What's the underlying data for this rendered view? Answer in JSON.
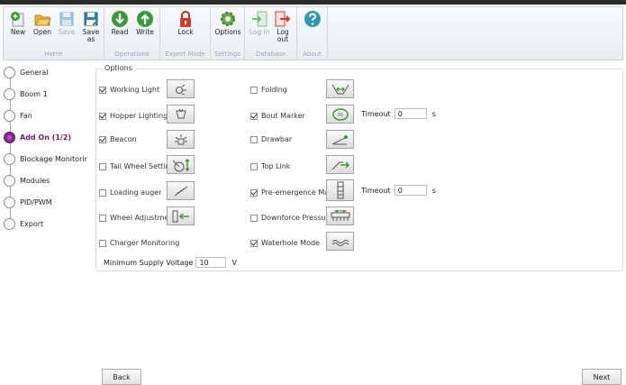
{
  "ribbon": {
    "groups": [
      {
        "label": "Home",
        "buttons": [
          {
            "label": "New"
          },
          {
            "label": "Open"
          },
          {
            "label": "Save"
          },
          {
            "label": "Save as"
          }
        ]
      },
      {
        "label": "Operations",
        "buttons": [
          {
            "label": "Read"
          },
          {
            "label": "Write"
          }
        ]
      },
      {
        "label": "Expert Mode",
        "buttons": [
          {
            "label": "Lock"
          }
        ]
      },
      {
        "label": "Settings",
        "buttons": [
          {
            "label": "Options"
          }
        ]
      },
      {
        "label": "Database",
        "buttons": [
          {
            "label": "Log in"
          },
          {
            "label": "Log out"
          }
        ]
      },
      {
        "label": "About",
        "buttons": [
          {
            "label": ""
          }
        ]
      }
    ]
  },
  "nav": {
    "items": [
      {
        "label": "General"
      },
      {
        "label": "Boom 1"
      },
      {
        "label": "Fan"
      },
      {
        "label": "Add On (1/2)"
      },
      {
        "label": "Blockage Monitorir"
      },
      {
        "label": "Modules"
      },
      {
        "label": "PID/PWM"
      },
      {
        "label": "Export"
      }
    ]
  },
  "options": {
    "title": "Options",
    "left": [
      {
        "label": "Working Light",
        "checked": true
      },
      {
        "label": "Hopper Lighting",
        "checked": true
      },
      {
        "label": "Beacon",
        "checked": true
      },
      {
        "label": "Tail Wheel Setting",
        "checked": false
      },
      {
        "label": "Loading auger",
        "checked": false
      },
      {
        "label": "Wheel Adjustment",
        "checked": false
      },
      {
        "label": "Charger Monitoring",
        "checked": false
      }
    ],
    "right": [
      {
        "label": "Folding",
        "checked": false
      },
      {
        "label": "Bout Marker",
        "checked": true
      },
      {
        "label": "Drawbar",
        "checked": false
      },
      {
        "label": "Top Link",
        "checked": false
      },
      {
        "label": "Pre-emergence Marker",
        "checked": true
      },
      {
        "label": "Downforce Pressure",
        "checked": false
      },
      {
        "label": "Waterhole Mode",
        "checked": true
      }
    ],
    "timeouts": [
      {
        "label": "Timeout",
        "value": "0",
        "unit": "s"
      },
      {
        "label": "Timeout",
        "value": "0",
        "unit": "s"
      }
    ],
    "min_voltage": {
      "label": "Minimum Supply Voltage",
      "value": "10",
      "unit": "V"
    }
  },
  "footer": {
    "back": "Back",
    "next": "Next"
  },
  "colors": {
    "accent": "#6b1c73",
    "green": "#3a9a3a",
    "red": "#d93a2b",
    "teal": "#2f9bb3"
  }
}
